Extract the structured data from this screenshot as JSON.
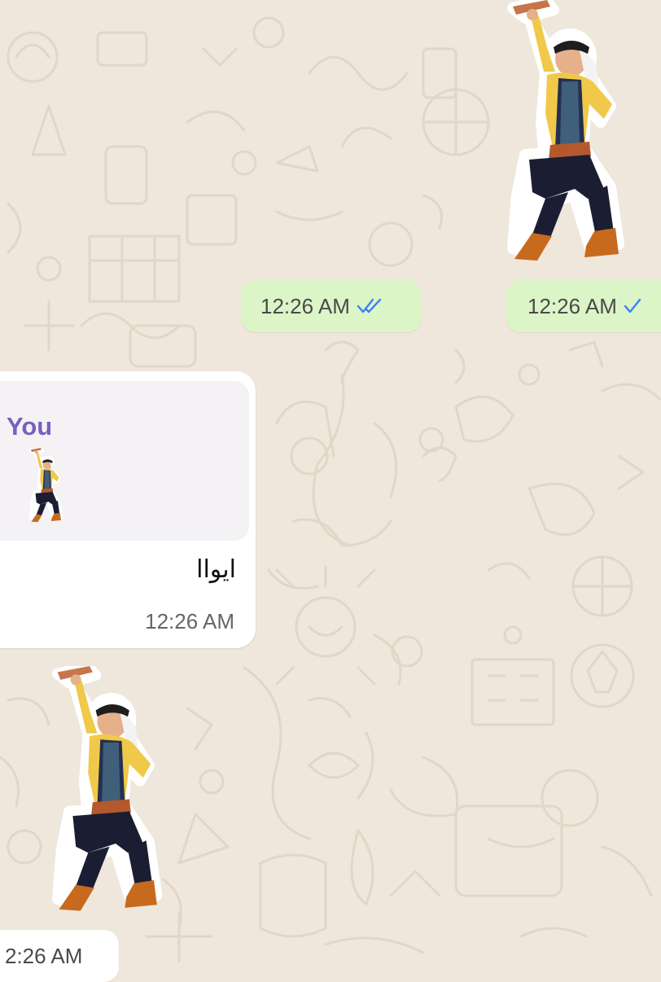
{
  "colors": {
    "wallpaper": "#efe7dc",
    "outgoing_bubble": "#dcf5c7",
    "incoming_bubble": "#ffffff",
    "quote_author": "#7a5fc0",
    "read_ticks": "#3b82f6"
  },
  "messages": [
    {
      "type": "sticker",
      "direction": "outgoing",
      "sticker": "dancing-man-sticker",
      "time": "12:26 AM",
      "status": "read"
    },
    {
      "type": "sticker",
      "direction": "outgoing",
      "sticker": "dancing-man-sticker",
      "time": "12:26 AM",
      "status": "read"
    },
    {
      "type": "reply",
      "direction": "incoming",
      "quoted_author": "You",
      "quoted_content": "dancing-man-sticker",
      "text": "ايواا",
      "time": "12:26 AM"
    },
    {
      "type": "sticker",
      "direction": "incoming",
      "sticker": "dancing-man-sticker",
      "time": "2:26 AM"
    }
  ]
}
